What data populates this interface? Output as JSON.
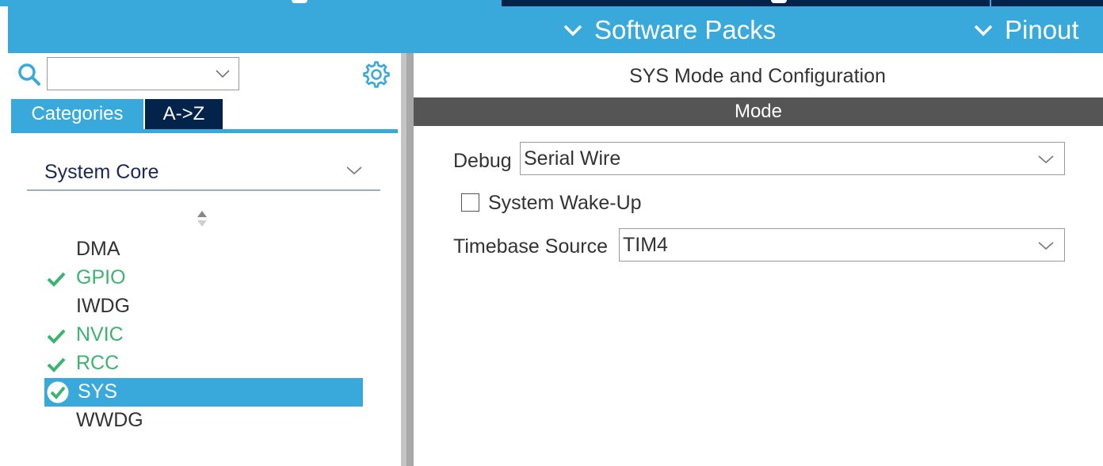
{
  "header": {
    "menus": [
      {
        "label": "Software Packs",
        "icon": "chevron-down-icon"
      },
      {
        "label": "Pinout",
        "icon": "chevron-down-icon"
      }
    ]
  },
  "left_panel": {
    "search": {
      "value": "",
      "icon": "search-icon"
    },
    "settings_icon": "gear-icon",
    "tabs": [
      {
        "label": "Categories",
        "active": true
      },
      {
        "label": "A->Z",
        "active": false
      }
    ],
    "category": {
      "label": "System Core"
    },
    "peripherals": [
      {
        "label": "DMA",
        "status": "none"
      },
      {
        "label": "GPIO",
        "status": "configured"
      },
      {
        "label": "IWDG",
        "status": "none"
      },
      {
        "label": "NVIC",
        "status": "configured"
      },
      {
        "label": "RCC",
        "status": "configured"
      },
      {
        "label": "SYS",
        "status": "configured",
        "selected": true
      },
      {
        "label": "WWDG",
        "status": "none"
      }
    ]
  },
  "right_panel": {
    "title": "SYS Mode and Configuration",
    "section": "Mode",
    "debug": {
      "label": "Debug",
      "value": "Serial Wire"
    },
    "system_wakeup": {
      "label": "System Wake-Up",
      "checked": false
    },
    "timebase": {
      "label": "Timebase Source",
      "value": "TIM4"
    }
  },
  "colors": {
    "accent": "#39a9dc",
    "dark_tab": "#03234b",
    "mode_bar": "#555555",
    "ok_green": "#3cb371",
    "category_text": "#1b2a55"
  }
}
